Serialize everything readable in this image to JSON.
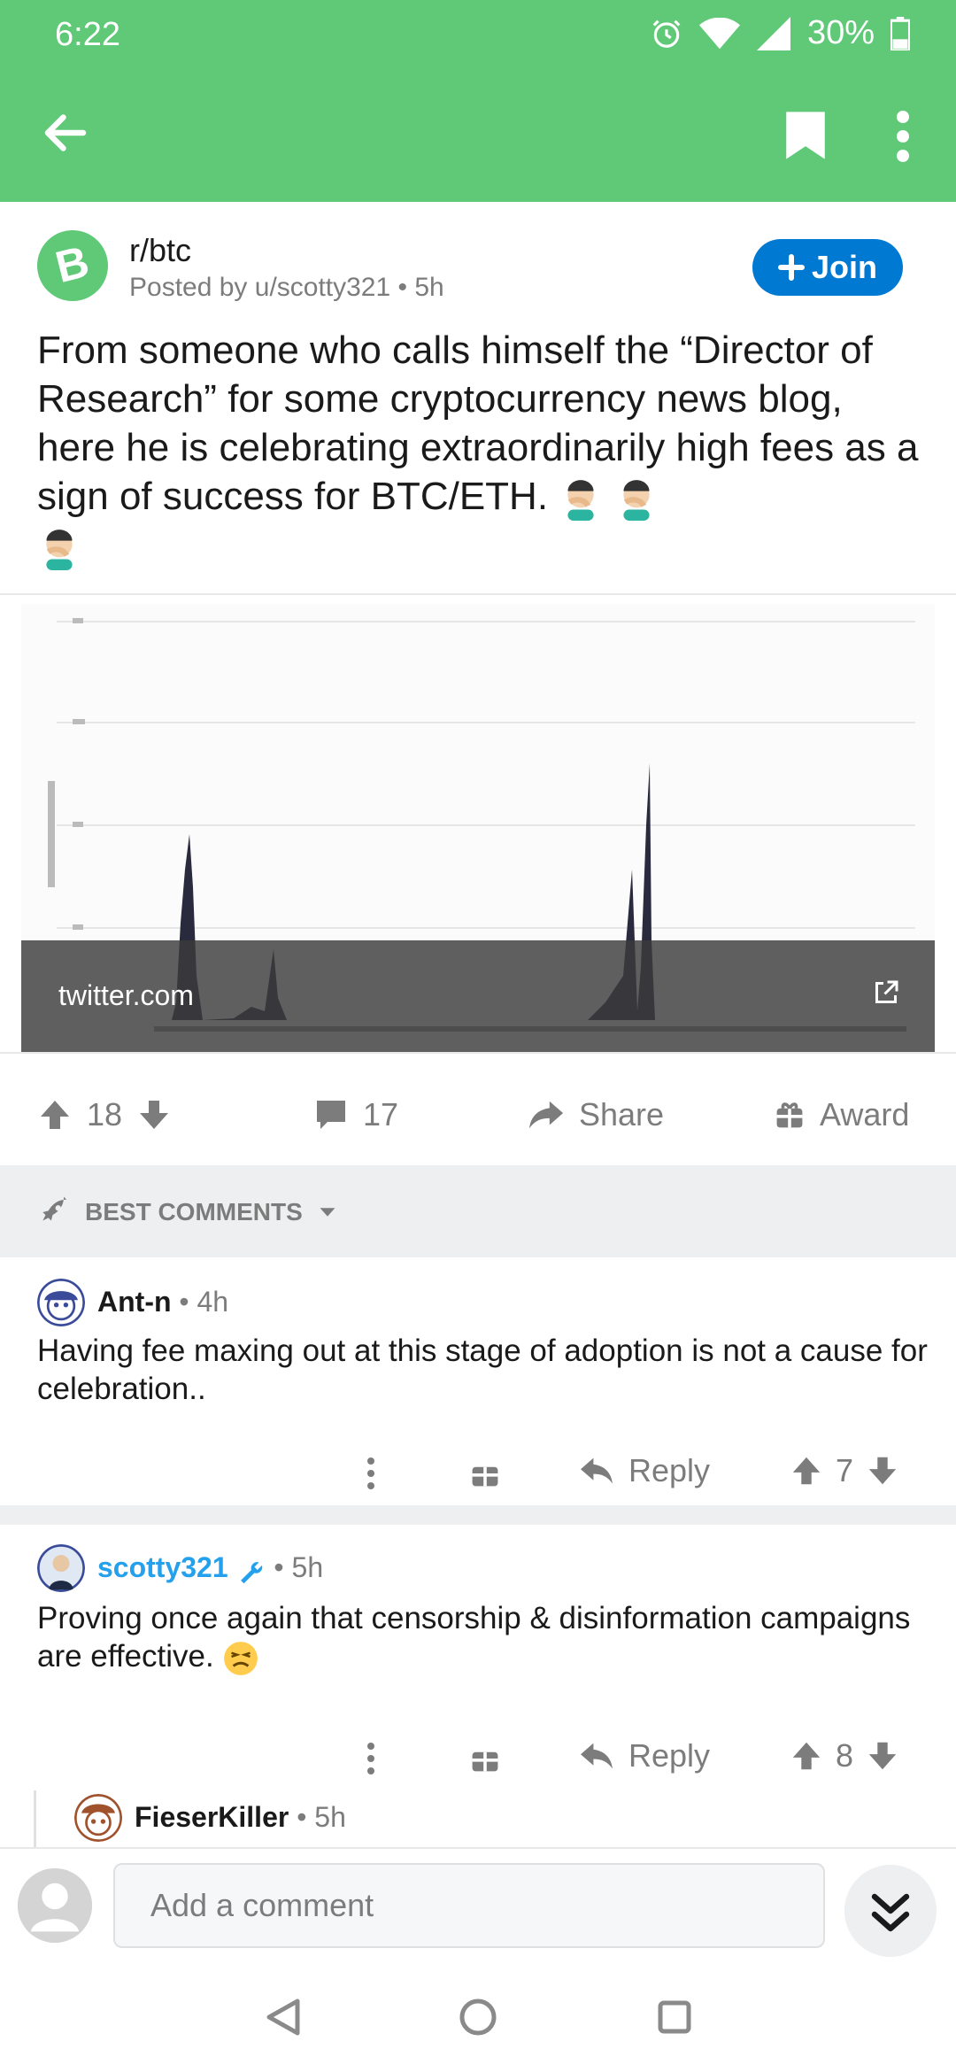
{
  "status_bar": {
    "time": "6:22",
    "battery": "30%"
  },
  "post": {
    "subreddit": "r/btc",
    "posted_by": "Posted by u/scotty321",
    "age": "5h",
    "join_label": "Join",
    "title": "From someone who calls himself the “Director of Research” for some cryptocurrency news blog, here he is celebrating extraordinarily high fees as a sign of success for BTC/ETH.",
    "link_domain": "twitter.com",
    "score": "18",
    "comments": "17",
    "share_label": "Share",
    "award_label": "Award"
  },
  "sort_label": "BEST COMMENTS",
  "comments": [
    {
      "author": "Ant-n",
      "age": "4h",
      "body": "Having fee maxing out at this stage of adoption is not a cause for celebration..",
      "reply_label": "Reply",
      "score": "7"
    },
    {
      "author": "scotty321",
      "age": "5h",
      "body": "Proving once again that censorship & disinformation campaigns are effective.",
      "reply_label": "Reply",
      "score": "8"
    },
    {
      "author": "FieserKiller",
      "age": "5h"
    }
  ],
  "composer": {
    "placeholder": "Add a comment"
  },
  "colors": {
    "header_green": "#5fc977",
    "join_blue": "#0079d3",
    "op_blue": "#24a0ed"
  },
  "icons": [
    "back-arrow-icon",
    "bookmark-icon",
    "more-vert-icon",
    "upvote-icon",
    "downvote-icon",
    "comment-icon",
    "share-icon",
    "gift-icon",
    "rocket-icon",
    "reply-icon",
    "mod-wrench-icon",
    "collapse-icon"
  ]
}
